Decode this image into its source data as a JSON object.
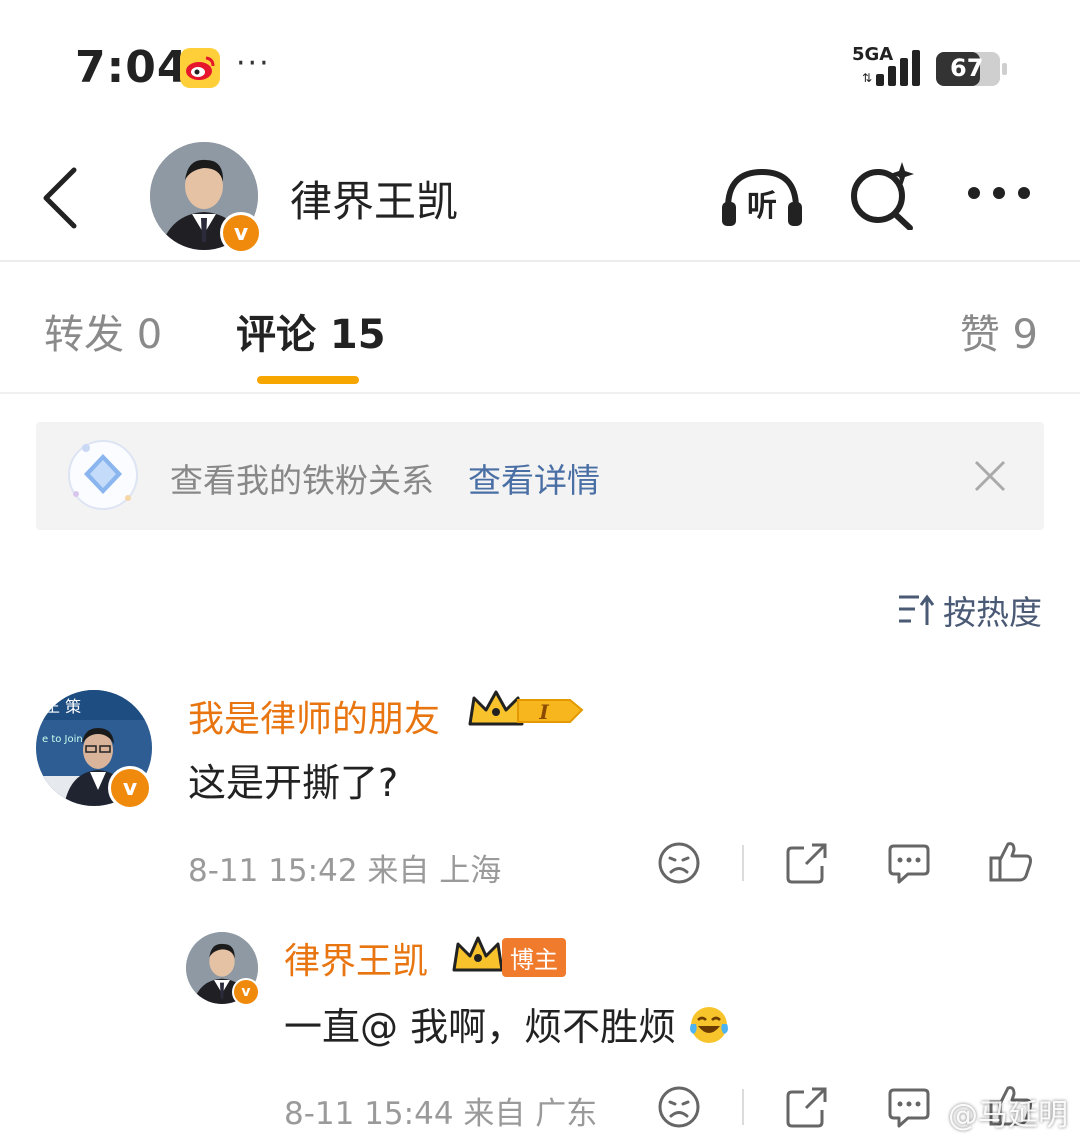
{
  "status_bar": {
    "time": "7:04",
    "network": "5GA",
    "battery": "67",
    "more": "···"
  },
  "header": {
    "title": "律界王凯"
  },
  "tabs": [
    {
      "label": "转发 0",
      "active": false
    },
    {
      "label": "评论 15",
      "active": true
    },
    {
      "label": "赞 9",
      "active": false
    }
  ],
  "banner": {
    "text": "查看我的铁粉关系",
    "link": "查看详情"
  },
  "sort": {
    "label": "按热度"
  },
  "comments": [
    {
      "username": "我是律师的朋友",
      "level": "I",
      "content": "这是开撕了?",
      "meta": "8-11 15:42 来自 上海",
      "reply": {
        "username": "律界王凯",
        "tag": "博主",
        "content": "一直@ 我啊，烦不胜烦",
        "meta": "8-11 15:44 来自 广东"
      }
    }
  ],
  "watermark": "@马延明",
  "colors": {
    "accent": "#f7a600",
    "username": "#e8750f",
    "link": "#4a6fa5",
    "verified": "#f08a0c"
  }
}
